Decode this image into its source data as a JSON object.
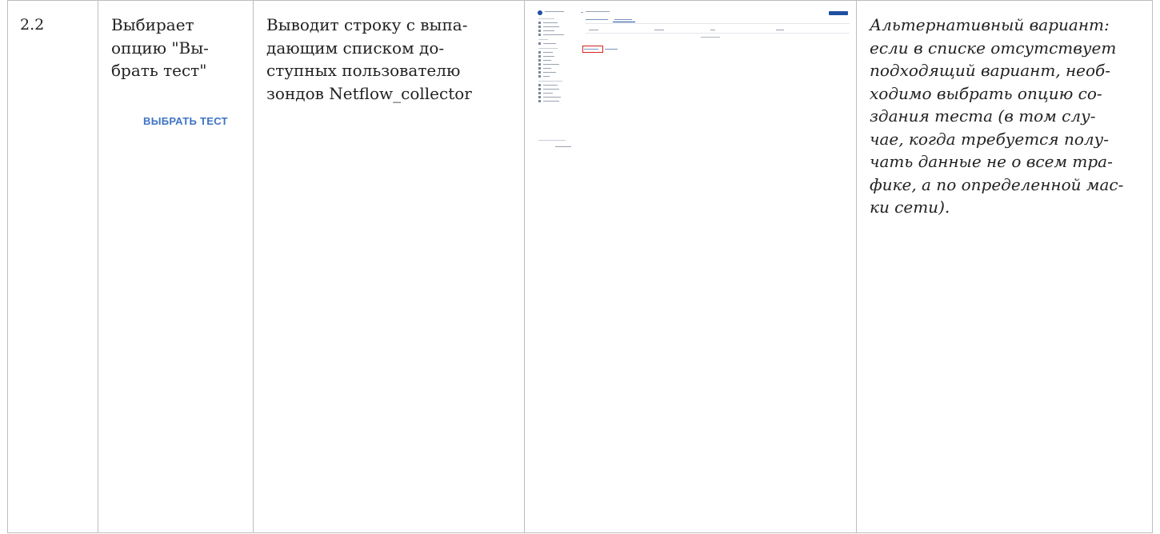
{
  "row": {
    "number": "2.2",
    "action_lines": [
      "Выбирает",
      "опцию \"Вы-",
      "брать тест\""
    ],
    "button_label": "ВЫБРАТЬ ТЕСТ",
    "result_lines": [
      "Выводит строку с выпа-",
      "дающим списком до-",
      "ступных пользователю",
      "зондов Netflow_collector"
    ],
    "alternative_lines": [
      "Альтернативный вариант:",
      "если в списке отсутствует",
      "подходящий вариант, необ-",
      "ходимо выбрать опцию со-",
      "здания теста (в том слу-",
      "чае, когда требуется полу-",
      "чать данные не о всем тра-",
      "фике, а по определенной мас-",
      "ки сети)."
    ]
  },
  "colors": {
    "button_text": "#3e74c5",
    "highlight_box": "#d62020",
    "accent": "#1f4fa0"
  },
  "screenshot_icons": [
    "logo-icon",
    "menu-icon",
    "sidebar-icons"
  ]
}
